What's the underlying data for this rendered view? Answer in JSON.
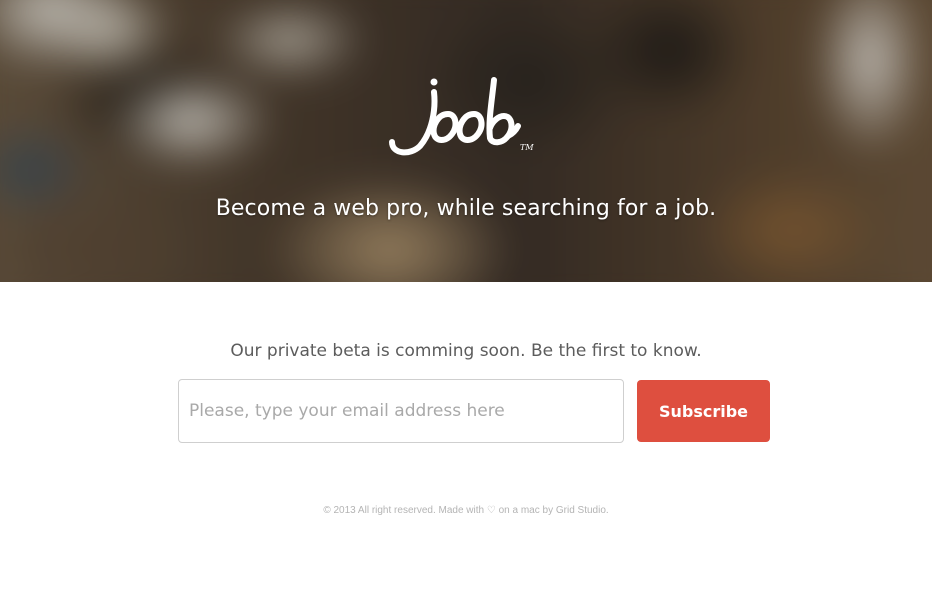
{
  "brand": {
    "logo_text": "joob",
    "trademark": "TM"
  },
  "hero": {
    "tagline": "Become a web pro, while searching for a job."
  },
  "main": {
    "beta_text": "Our private beta is comming soon. Be the first to know.",
    "email_placeholder": "Please, type your email address here",
    "email_value": "",
    "subscribe_label": "Subscribe"
  },
  "footer": {
    "text": "© 2013 All right reserved. Made with ♡ on a mac by Grid Studio."
  },
  "colors": {
    "accent": "#de4f3f",
    "text_muted": "#5c5c5c",
    "footer_text": "#b4b4b4"
  }
}
